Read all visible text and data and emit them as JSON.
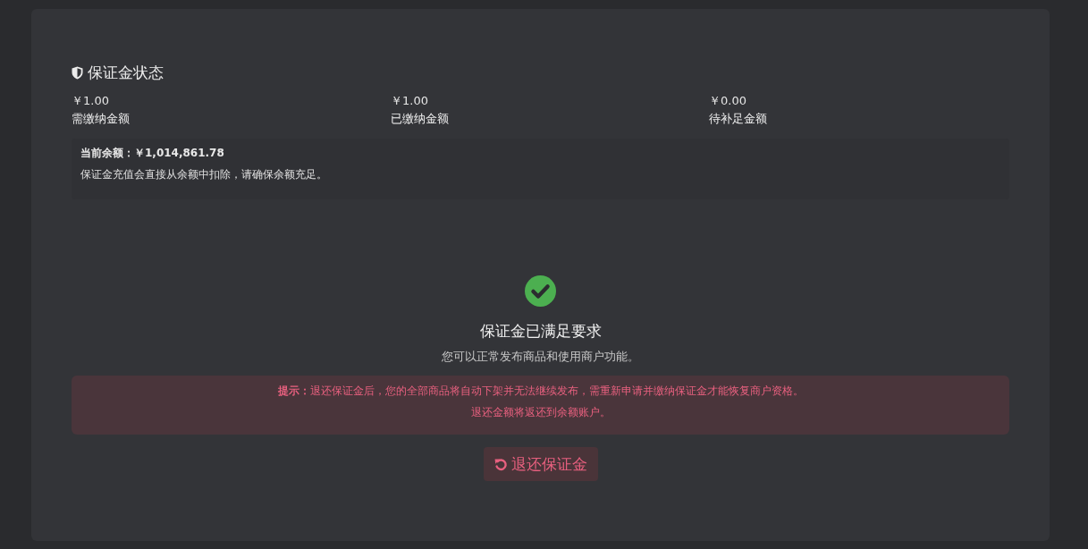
{
  "section": {
    "title": "保证金状态"
  },
  "stats": [
    {
      "amount": "￥1.00",
      "label": "需缴纳金额"
    },
    {
      "amount": "￥1.00",
      "label": "已缴纳金额"
    },
    {
      "amount": "￥0.00",
      "label": "待补足金额"
    }
  ],
  "balance": {
    "line": "当前余额：￥1,014,861.78",
    "note": "保证金充值会直接从余额中扣除，请确保余额充足。"
  },
  "status": {
    "kind": "satisfied",
    "title": "保证金已满足要求",
    "description": "您可以正常发布商品和使用商户功能。"
  },
  "warning": {
    "lines": [
      "**提示：**退还保证金后，您的全部商品将自动下架并无法继续发布，需重新申请并缴纳保证金才能恢复商户资格。",
      "退还金额将返还到余额账户。"
    ]
  },
  "refund_button": {
    "label": "退还保证金"
  }
}
